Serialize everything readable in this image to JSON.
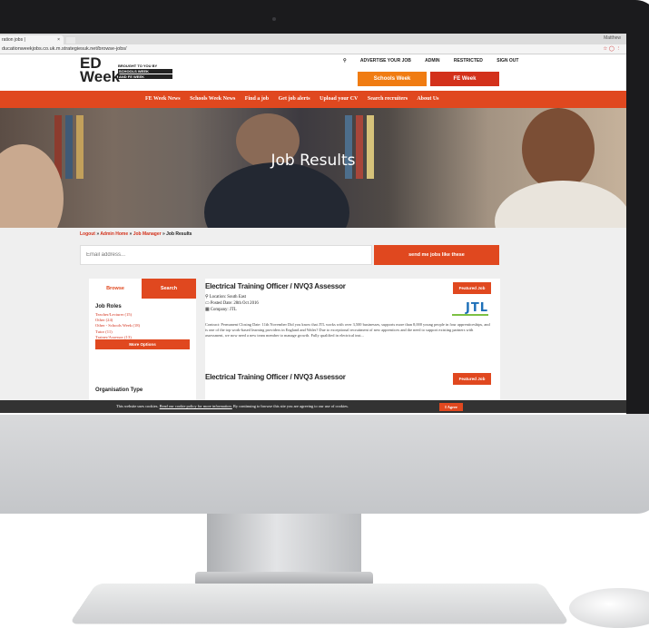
{
  "browser": {
    "tab_title": "ration jobs |",
    "tab_close": "×",
    "user": "Matthew",
    "url": "ducationweekjobs.co.uk.m.strategiesuk.net/browse-jobs/"
  },
  "header": {
    "logo_ed": "ED",
    "logo_week": "Week",
    "logo_brought": "BROUGHT TO YOU BY",
    "logo_schools": "SCHOOLS WEEK",
    "logo_fe": "AND FE WEEK",
    "top_links": [
      "ADVERTISE YOUR JOB",
      "ADMIN",
      "RESTRICTED",
      "SIGN OUT"
    ],
    "schools_week_btn": "Schools Week",
    "fe_week_btn": "FE Week"
  },
  "nav": {
    "items": [
      "FE Week News",
      "Schools Week News",
      "Find a job",
      "Get job alerts",
      "Upload your CV",
      "Search recruiters",
      "About Us"
    ]
  },
  "hero": {
    "title": "Job Results"
  },
  "breadcrumb": {
    "logout": "Logout",
    "admin_home": "Admin Home",
    "job_manager": "Job Manager",
    "current": "Job Results",
    "sep": " » "
  },
  "alerts": {
    "email_placeholder": "Email address...",
    "send_btn": "send me jobs like these"
  },
  "sidebar": {
    "browse_tab": "Browse",
    "search_tab": "Search",
    "job_roles_heading": "Job Roles",
    "roles": [
      {
        "label": "Teacher/Lecturer",
        "count": "(15)"
      },
      {
        "label": "Other",
        "count": "(24)"
      },
      {
        "label": "Other - Schools Week",
        "count": "(18)"
      },
      {
        "label": "Tutor",
        "count": "(11)"
      },
      {
        "label": "Trainer/Assessor",
        "count": "(13)"
      }
    ],
    "more_options": "More Options",
    "org_type_heading": "Organisation Type"
  },
  "jobs": [
    {
      "title": "Electrical Training Officer / NVQ3 Assessor",
      "location": "Location: South East",
      "posted": "Posted Date: 28th Oct 2016",
      "company": "Company: JTL",
      "featured": "Featured Job",
      "logo_text": "JTL",
      "description": "Contract: Permanent Closing Date: 11th November Did you know that JTL works with over 3,500 businesses, supports more than 8,000 young people in four apprenticeships, and is one of the top work-based learning providers in England and Wales? Due to exceptional recruitment of new apprentices and the need to support existing partners with assessment, we now need a new team member to manage growth. Fully qualified in electrical inst..."
    },
    {
      "title": "Electrical Training Officer / NVQ3 Assessor",
      "featured": "Featured Job"
    }
  ],
  "cookie": {
    "text_before": "This website uses cookies. ",
    "link": "Read our cookie policy for more information.",
    "text_after": " By continuing to browse this site you are agreeing to our use of cookies.",
    "agree_btn": "I Agree"
  },
  "colors": {
    "accent_orange": "#e0481f",
    "schools_orange": "#f07c12",
    "fe_red": "#d3311b"
  }
}
